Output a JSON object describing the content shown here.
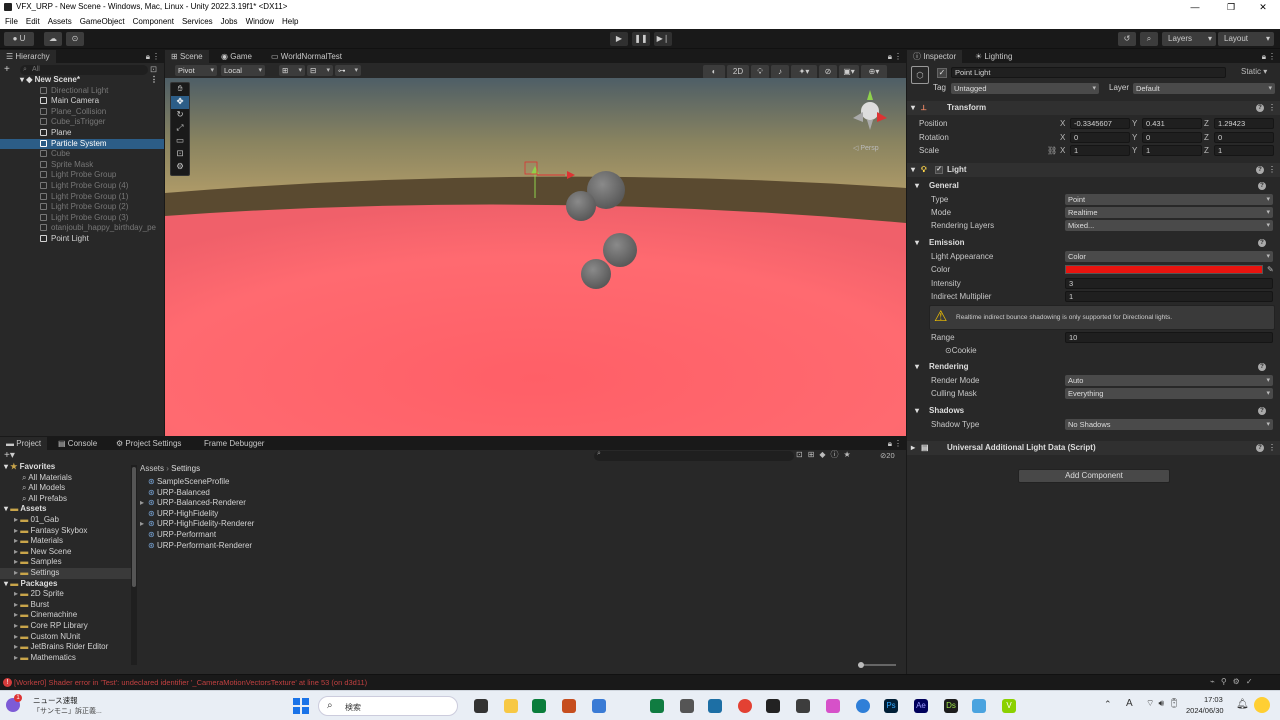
{
  "window": {
    "title": "VFX_URP - New Scene - Windows, Mac, Linux - Unity 2022.3.19f1* <DX11>",
    "minimize": "—",
    "maximize": "❐",
    "close": "✕"
  },
  "menu": [
    "File",
    "Edit",
    "Assets",
    "GameObject",
    "Component",
    "Services",
    "Jobs",
    "Window",
    "Help"
  ],
  "toolbar": {
    "account": "U",
    "layers": "Layers",
    "layout": "Layout",
    "play": "▶",
    "pause": "❚❚",
    "step": "▶❘"
  },
  "hierarchy": {
    "tab": "Hierarchy",
    "search_placeholder": "All",
    "scene": "New Scene*",
    "items": [
      {
        "label": "Directional Light",
        "dim": true
      },
      {
        "label": "Main Camera",
        "dim": false
      },
      {
        "label": "Plane_Collision",
        "dim": true
      },
      {
        "label": "Cube_isTrigger",
        "dim": true
      },
      {
        "label": "Plane",
        "dim": false
      },
      {
        "label": "Particle System",
        "dim": false,
        "selected": true
      },
      {
        "label": "Cube",
        "dim": true
      },
      {
        "label": "Sprite Mask",
        "dim": true
      },
      {
        "label": "Light Probe Group",
        "dim": true
      },
      {
        "label": "Light Probe Group (4)",
        "dim": true
      },
      {
        "label": "Light Probe Group (1)",
        "dim": true
      },
      {
        "label": "Light Probe Group (2)",
        "dim": true
      },
      {
        "label": "Light Probe Group (3)",
        "dim": true
      },
      {
        "label": "otanjoubi_happy_birthday_pe",
        "dim": true
      },
      {
        "label": "Point Light",
        "dim": false
      }
    ]
  },
  "scene_view": {
    "tabs": [
      "Scene",
      "Game",
      "WorldNormalTest"
    ],
    "pivot": "Pivot",
    "local": "Local",
    "mode_2d": "2D",
    "persp_label": "◁ Persp"
  },
  "project": {
    "tabs": [
      "Project",
      "Console",
      "Project Settings",
      "Frame Debugger"
    ],
    "favorites": {
      "title": "Favorites",
      "items": [
        "All Materials",
        "All Models",
        "All Prefabs"
      ]
    },
    "assets": {
      "title": "Assets",
      "items": [
        "01_Gab",
        "Fantasy Skybox",
        "Materials",
        "New Scene",
        "Samples",
        "Settings"
      ]
    },
    "packages": {
      "title": "Packages",
      "items": [
        "2D Sprite",
        "Burst",
        "Cinemachine",
        "Core RP Library",
        "Custom NUnit",
        "JetBrains Rider Editor",
        "Mathematics"
      ]
    },
    "breadcrumb": [
      "Assets",
      "Settings"
    ],
    "files": [
      "SampleSceneProfile",
      "URP-Balanced",
      "URP-Balanced-Renderer",
      "URP-HighFidelity",
      "URP-HighFidelity-Renderer",
      "URP-Performant",
      "URP-Performant-Renderer"
    ],
    "hidden_count": "20"
  },
  "inspector": {
    "tabs": [
      "Inspector",
      "Lighting"
    ],
    "object_name": "Point Light",
    "static_label": "Static",
    "tag_label": "Tag",
    "tag_value": "Untagged",
    "layer_label": "Layer",
    "layer_value": "Default",
    "transform": {
      "title": "Transform",
      "rows": [
        {
          "label": "Position",
          "x": "-0.3345607",
          "y": "0.431",
          "z": "1.29423"
        },
        {
          "label": "Rotation",
          "x": "0",
          "y": "0",
          "z": "0"
        },
        {
          "label": "Scale",
          "x": "1",
          "y": "1",
          "z": "1"
        }
      ]
    },
    "light": {
      "title": "Light",
      "general": "General",
      "type_label": "Type",
      "type_value": "Point",
      "mode_label": "Mode",
      "mode_value": "Realtime",
      "rl_label": "Rendering Layers",
      "rl_value": "Mixed...",
      "emission": "Emission",
      "appearance_label": "Light Appearance",
      "appearance_value": "Color",
      "color_label": "Color",
      "color_value": "#e8140f",
      "intensity_label": "Intensity",
      "intensity_value": "3",
      "indirect_label": "Indirect Multiplier",
      "indirect_value": "1",
      "warning": "Realtime indirect bounce shadowing is only supported for Directional lights.",
      "range_label": "Range",
      "range_value": "10",
      "cookie_label": "Cookie",
      "rendering": "Rendering",
      "render_mode_label": "Render Mode",
      "render_mode_value": "Auto",
      "culling_label": "Culling Mask",
      "culling_value": "Everything",
      "shadows": "Shadows",
      "shadow_type_label": "Shadow Type",
      "shadow_type_value": "No Shadows"
    },
    "urp_data": "Universal Additional Light Data (Script)",
    "add_component": "Add Component"
  },
  "status": {
    "error": "[Worker0] Shader error in 'Test': undeclared identifier '_CameraMotionVectorsTexture' at line 53 (on d3d11)"
  },
  "taskbar": {
    "news_title": "ニュース速報",
    "news_sub": "「サンモニ」訴正義...",
    "search": "検索",
    "time": "17:03",
    "date": "2024/06/30",
    "lang": "A",
    "badge": "1"
  }
}
